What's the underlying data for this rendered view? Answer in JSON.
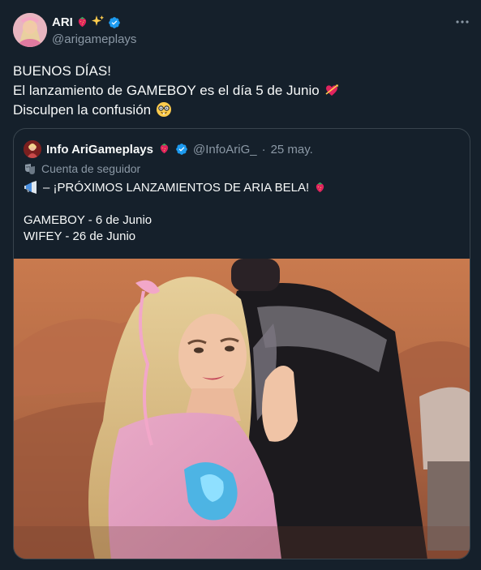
{
  "author": {
    "name": "ARI",
    "handle": "@arigameplays",
    "name_emojis": [
      "strawberry-emoji",
      "sparkles-emoji"
    ]
  },
  "tweet": {
    "line1": "BUENOS DÍAS!",
    "line2": "El lanzamiento de GAMEBOY es el día 5 de Junio",
    "line3": "Disculpen la confusión"
  },
  "quote": {
    "name": "Info AriGameplays",
    "handle": "@InfoAriG_",
    "separator": "·",
    "date": "25 may.",
    "context": "Cuenta de seguidor",
    "line1": "– ¡PRÓXIMOS LANZAMIENTOS DE ARIA BELA!",
    "line3": "GAMEBOY - 6 de Junio",
    "line4": "WIFEY - 26 de Junio"
  },
  "colors": {
    "background": "#15202b",
    "text": "#f7f9f9",
    "secondary": "#8b98a5",
    "border": "#38444d",
    "verified": "#1d9bf0"
  }
}
